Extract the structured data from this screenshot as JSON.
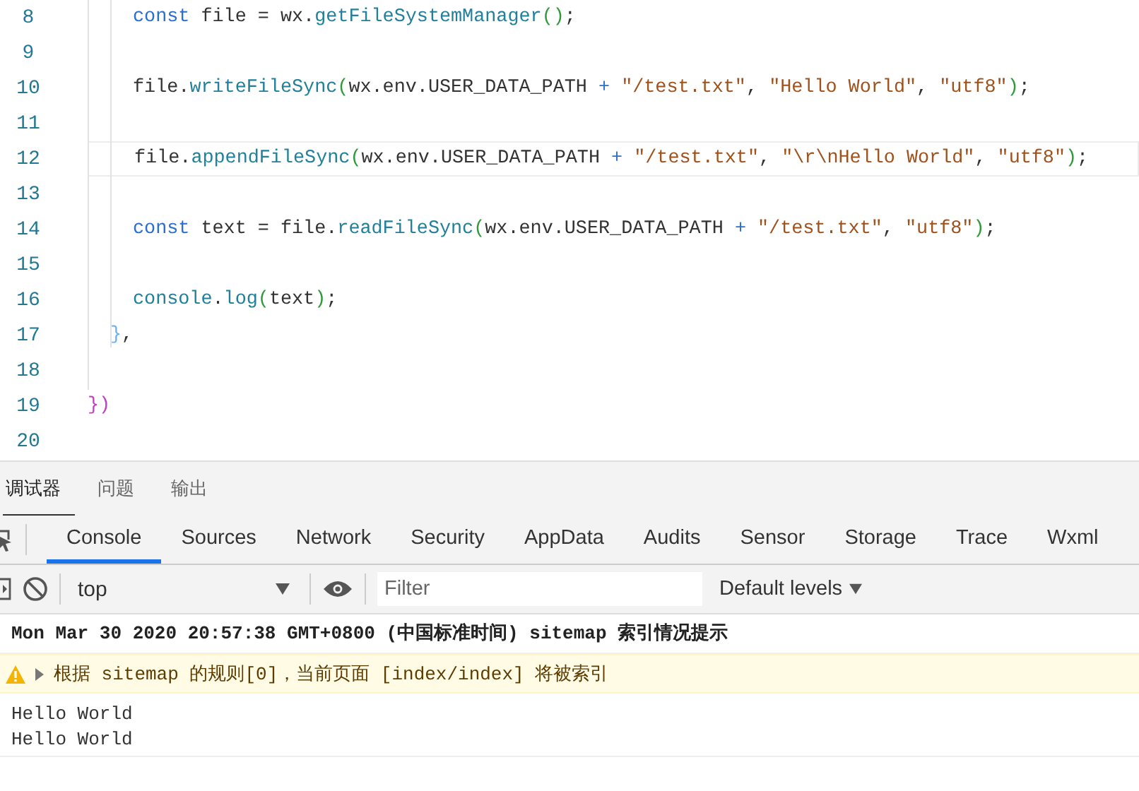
{
  "editor": {
    "lines": [
      {
        "number": "8",
        "current": false,
        "kind": "statement",
        "tokens": [
          {
            "kind": "keyword",
            "text": "const"
          },
          {
            "kind": "plain",
            "text": " file = wx."
          },
          {
            "kind": "method",
            "text": "getFileSystemManager"
          },
          {
            "kind": "paren",
            "text": "()"
          },
          {
            "kind": "plain",
            "text": ";"
          }
        ]
      },
      {
        "number": "9",
        "current": false,
        "kind": "blank"
      },
      {
        "number": "10",
        "current": false,
        "kind": "statement",
        "tokens": [
          {
            "kind": "plain",
            "text": "file."
          },
          {
            "kind": "method",
            "text": "writeFileSync"
          },
          {
            "kind": "paren",
            "text": "("
          },
          {
            "kind": "plain",
            "text": "wx.env.USER_DATA_PATH "
          },
          {
            "kind": "keyword",
            "text": "+ "
          },
          {
            "kind": "string",
            "text": "\"/test.txt\""
          },
          {
            "kind": "plain",
            "text": ", "
          },
          {
            "kind": "string",
            "text": "\"Hello World\""
          },
          {
            "kind": "plain",
            "text": ", "
          },
          {
            "kind": "string",
            "text": "\"utf8\""
          },
          {
            "kind": "paren",
            "text": ")"
          },
          {
            "kind": "plain",
            "text": ";"
          }
        ]
      },
      {
        "number": "11",
        "current": false,
        "kind": "blank"
      },
      {
        "number": "12",
        "current": true,
        "kind": "statement",
        "tokens": [
          {
            "kind": "plain",
            "text": "file."
          },
          {
            "kind": "method",
            "text": "appendFileSync"
          },
          {
            "kind": "paren",
            "text": "("
          },
          {
            "kind": "plain",
            "text": "wx.env.USER_DATA_PATH "
          },
          {
            "kind": "keyword",
            "text": "+ "
          },
          {
            "kind": "string",
            "text": "\"/test.txt\""
          },
          {
            "kind": "plain",
            "text": ", "
          },
          {
            "kind": "string",
            "text": "\"\\r\\nHello World\""
          },
          {
            "kind": "plain",
            "text": ", "
          },
          {
            "kind": "string",
            "text": "\"utf8\""
          },
          {
            "kind": "paren",
            "text": ")"
          },
          {
            "kind": "plain",
            "text": ";"
          }
        ]
      },
      {
        "number": "13",
        "current": false,
        "kind": "blank"
      },
      {
        "number": "14",
        "current": false,
        "kind": "statement",
        "tokens": [
          {
            "kind": "keyword",
            "text": "const"
          },
          {
            "kind": "plain",
            "text": " text = file."
          },
          {
            "kind": "method",
            "text": "readFileSync"
          },
          {
            "kind": "paren",
            "text": "("
          },
          {
            "kind": "plain",
            "text": "wx.env.USER_DATA_PATH "
          },
          {
            "kind": "keyword",
            "text": "+ "
          },
          {
            "kind": "string",
            "text": "\"/test.txt\""
          },
          {
            "kind": "plain",
            "text": ", "
          },
          {
            "kind": "string",
            "text": "\"utf8\""
          },
          {
            "kind": "paren",
            "text": ")"
          },
          {
            "kind": "plain",
            "text": ";"
          }
        ]
      },
      {
        "number": "15",
        "current": false,
        "kind": "blank"
      },
      {
        "number": "16",
        "current": false,
        "kind": "statement",
        "tokens": [
          {
            "kind": "method",
            "text": "console"
          },
          {
            "kind": "plain",
            "text": "."
          },
          {
            "kind": "method",
            "text": "log"
          },
          {
            "kind": "paren",
            "text": "("
          },
          {
            "kind": "plain",
            "text": "text"
          },
          {
            "kind": "paren",
            "text": ")"
          },
          {
            "kind": "plain",
            "text": ";"
          }
        ]
      },
      {
        "number": "17",
        "current": false,
        "kind": "block_end",
        "tokens": [
          {
            "kind": "brace",
            "text": "}"
          },
          {
            "kind": "plain",
            "text": ","
          }
        ]
      },
      {
        "number": "18",
        "current": false,
        "kind": "blank"
      },
      {
        "number": "19",
        "current": false,
        "kind": "call_end",
        "tokens": [
          {
            "kind": "outer",
            "text": "})"
          }
        ]
      },
      {
        "number": "20",
        "current": false,
        "kind": "blank"
      }
    ]
  },
  "panel_tabs": [
    {
      "label": "调试器",
      "selected": true
    },
    {
      "label": "问题",
      "selected": false
    },
    {
      "label": "输出",
      "selected": false
    }
  ],
  "devtools_tabs": [
    {
      "label": "Console",
      "selected": true
    },
    {
      "label": "Sources",
      "selected": false
    },
    {
      "label": "Network",
      "selected": false
    },
    {
      "label": "Security",
      "selected": false
    },
    {
      "label": "AppData",
      "selected": false
    },
    {
      "label": "Audits",
      "selected": false
    },
    {
      "label": "Sensor",
      "selected": false
    },
    {
      "label": "Storage",
      "selected": false
    },
    {
      "label": "Trace",
      "selected": false
    },
    {
      "label": "Wxml",
      "selected": false
    }
  ],
  "toolbar": {
    "context": "top",
    "filter": {
      "placeholder": "Filter"
    },
    "levels": "Default levels"
  },
  "console": [
    {
      "kind": "info",
      "text": "Mon Mar 30 2020 20:57:38 GMT+0800 (中国标准时间) sitemap 索引情况提示"
    },
    {
      "kind": "warning",
      "text": "根据 sitemap 的规则[0]，当前页面 [index/index] 将被索引"
    },
    {
      "kind": "log",
      "text": "Hello World"
    },
    {
      "kind": "log",
      "text": "Hello World"
    }
  ]
}
